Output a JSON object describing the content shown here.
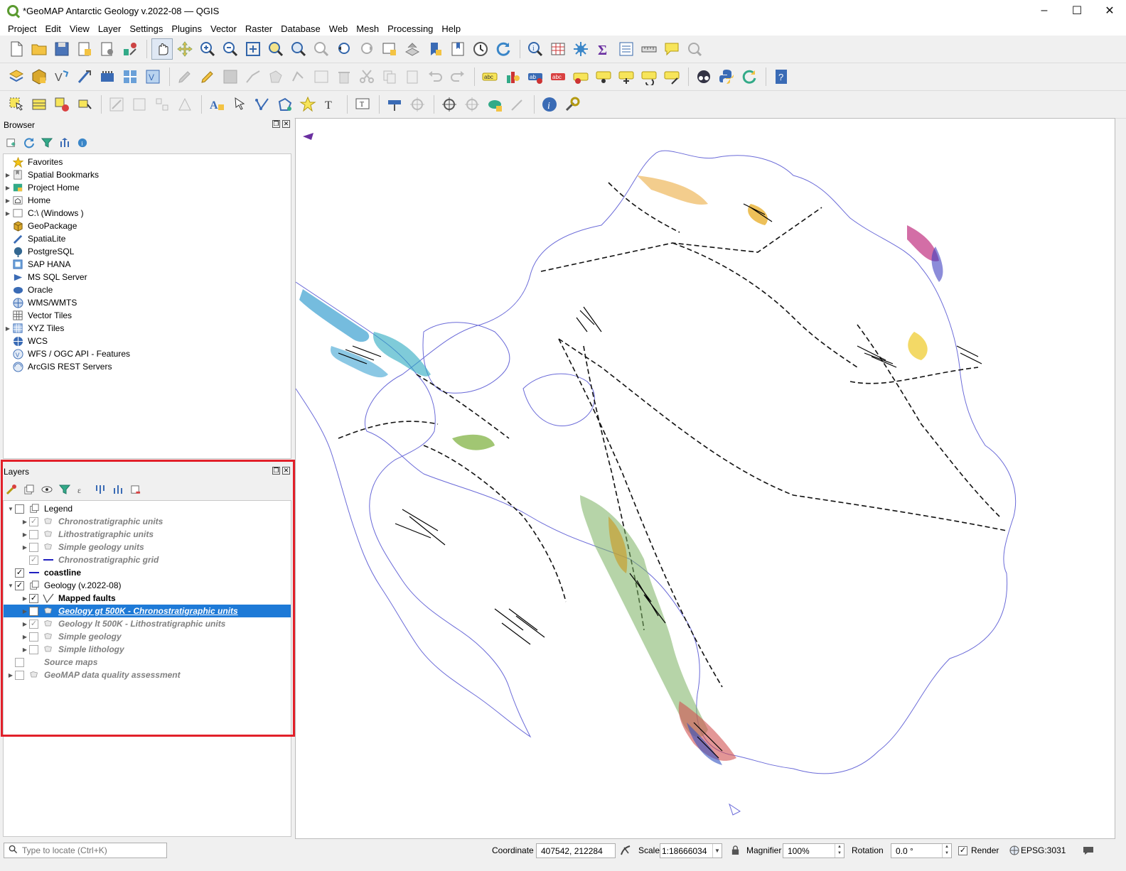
{
  "window": {
    "title": "*GeoMAP Antarctic Geology v.2022-08 — QGIS",
    "controls": [
      "–",
      "☐",
      "✕"
    ]
  },
  "menu": [
    "Project",
    "Edit",
    "View",
    "Layer",
    "Settings",
    "Plugins",
    "Vector",
    "Raster",
    "Database",
    "Web",
    "Mesh",
    "Processing",
    "Help"
  ],
  "browser": {
    "title": "Browser",
    "items": [
      {
        "label": "Favorites",
        "icon": "star-icon",
        "expandable": false
      },
      {
        "label": "Spatial Bookmarks",
        "icon": "bookmark-icon",
        "expandable": true
      },
      {
        "label": "Project Home",
        "icon": "project-home-icon",
        "expandable": true
      },
      {
        "label": "Home",
        "icon": "home-icon",
        "expandable": true
      },
      {
        "label": "C:\\ (Windows )",
        "icon": "drive-icon",
        "expandable": true
      },
      {
        "label": "GeoPackage",
        "icon": "geopackage-icon",
        "expandable": false
      },
      {
        "label": "SpatiaLite",
        "icon": "spatialite-icon",
        "expandable": false
      },
      {
        "label": "PostgreSQL",
        "icon": "postgresql-icon",
        "expandable": false
      },
      {
        "label": "SAP HANA",
        "icon": "sap-hana-icon",
        "expandable": false
      },
      {
        "label": "MS SQL Server",
        "icon": "mssql-icon",
        "expandable": false
      },
      {
        "label": "Oracle",
        "icon": "oracle-icon",
        "expandable": false
      },
      {
        "label": "WMS/WMTS",
        "icon": "wms-icon",
        "expandable": false
      },
      {
        "label": "Vector Tiles",
        "icon": "vector-tiles-icon",
        "expandable": false
      },
      {
        "label": "XYZ Tiles",
        "icon": "xyz-tiles-icon",
        "expandable": true
      },
      {
        "label": "WCS",
        "icon": "wcs-icon",
        "expandable": false
      },
      {
        "label": "WFS / OGC API - Features",
        "icon": "wfs-icon",
        "expandable": false
      },
      {
        "label": "ArcGIS REST Servers",
        "icon": "arcgis-icon",
        "expandable": false
      }
    ]
  },
  "layers": {
    "title": "Layers",
    "items": [
      {
        "label": "Legend",
        "level": 0,
        "arrow": "▼",
        "checked": false,
        "icon": "group-icon",
        "style": "normal"
      },
      {
        "label": "Chronostratigraphic units",
        "level": 1,
        "arrow": "▶",
        "checked": true,
        "icon": "polygon-icon",
        "style": "grey-italic"
      },
      {
        "label": "Lithostratigraphic units",
        "level": 1,
        "arrow": "▶",
        "checked": false,
        "icon": "polygon-icon",
        "style": "grey-italic"
      },
      {
        "label": "Simple geology units",
        "level": 1,
        "arrow": "▶",
        "checked": false,
        "icon": "polygon-icon",
        "style": "grey-italic"
      },
      {
        "label": "Chronostratigraphic grid",
        "level": 1,
        "arrow": "",
        "checked": true,
        "icon": "line-icon",
        "style": "grey-italic"
      },
      {
        "label": "coastline",
        "level": 0,
        "arrow": "",
        "checked": true,
        "icon": "line-icon",
        "style": "bold"
      },
      {
        "label": "Geology (v.2022-08)",
        "level": 0,
        "arrow": "▼",
        "checked": true,
        "icon": "group-icon",
        "style": "normal"
      },
      {
        "label": "Mapped faults",
        "level": 1,
        "arrow": "▶",
        "checked": true,
        "icon": "fault-icon",
        "style": "bold"
      },
      {
        "label": "Geology gt 500K - Chronostratigraphic units",
        "level": 1,
        "arrow": "▶",
        "checked": true,
        "icon": "polygon-icon",
        "style": "selected"
      },
      {
        "label": "Geology lt 500K - Lithostratigraphic units",
        "level": 1,
        "arrow": "▶",
        "checked": true,
        "icon": "polygon-icon",
        "style": "grey-italic"
      },
      {
        "label": "Simple geology",
        "level": 1,
        "arrow": "▶",
        "checked": false,
        "icon": "polygon-icon",
        "style": "grey-italic"
      },
      {
        "label": "Simple lithology",
        "level": 1,
        "arrow": "▶",
        "checked": false,
        "icon": "polygon-icon",
        "style": "grey-italic"
      },
      {
        "label": "Source maps",
        "level": 0,
        "arrow": "",
        "checked": false,
        "icon": "",
        "style": "grey-italic"
      },
      {
        "label": "GeoMAP data quality assessment",
        "level": 0,
        "arrow": "▶",
        "checked": false,
        "icon": "polygon-icon",
        "style": "grey-italic"
      }
    ]
  },
  "status": {
    "locator_placeholder": "Type to locate (Ctrl+K)",
    "coordinate_label": "Coordinate",
    "coordinate_value": "407542, 212284",
    "scale_label": "Scale",
    "scale_value": "1:18666034",
    "magnifier_label": "Magnifier",
    "magnifier_value": "100%",
    "rotation_label": "Rotation",
    "rotation_value": "0.0 °",
    "render_label": "Render",
    "crs": "EPSG:3031"
  },
  "colors": {
    "selection": "#1e7ad7",
    "highlight_border": "#e2202a",
    "coastline": "#6a6ad8"
  }
}
